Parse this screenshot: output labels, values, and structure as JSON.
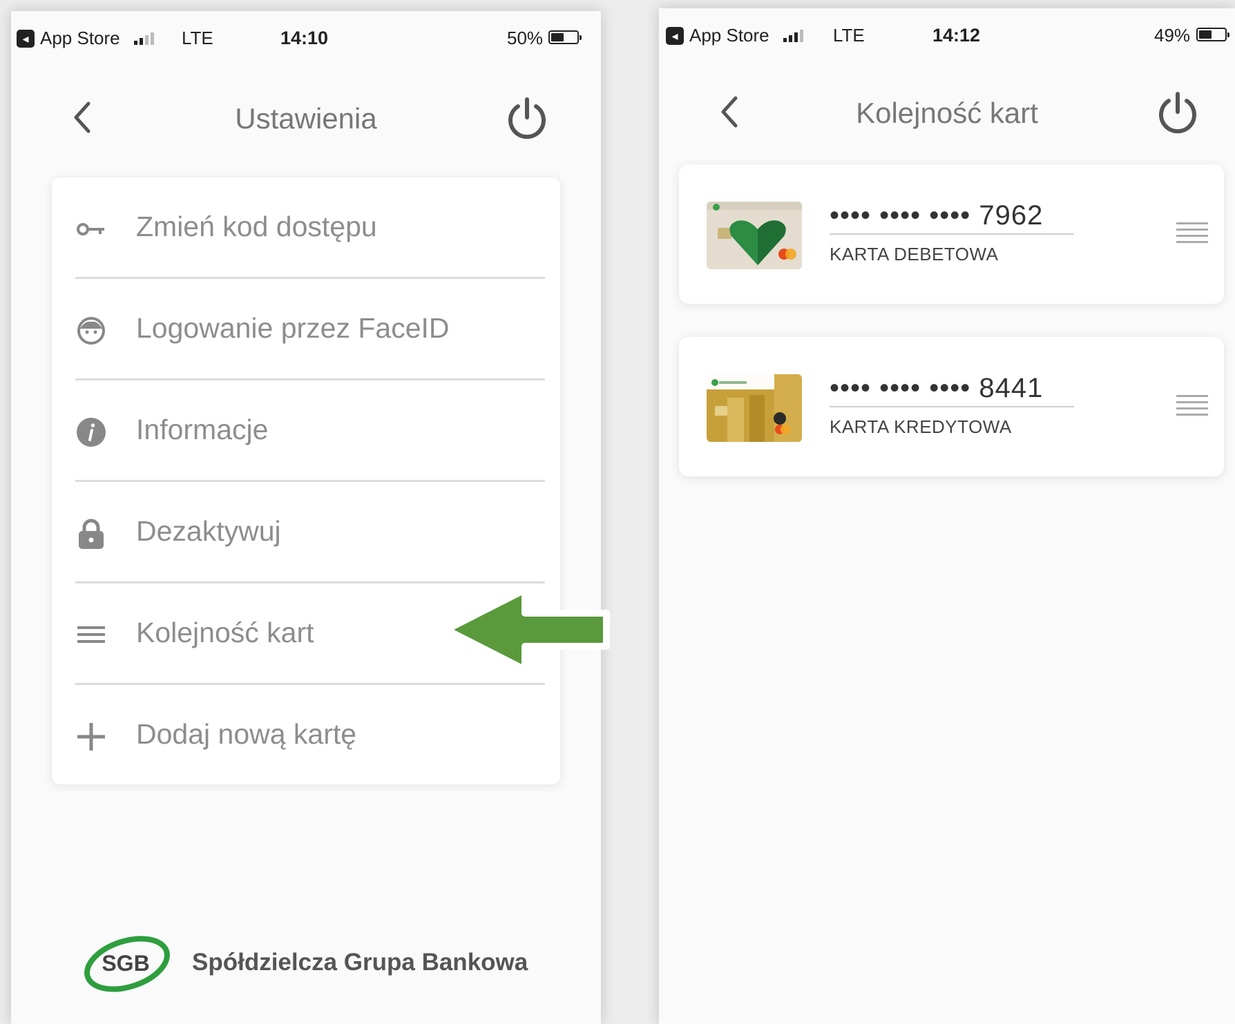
{
  "left_screen": {
    "status_bar": {
      "back_app": "App Store",
      "network": "LTE",
      "time": "14:10",
      "battery": "50%",
      "battery_level": 0.5
    },
    "header": {
      "title": "Ustawienia",
      "back_icon": "chevron-left-icon",
      "power_icon": "power-icon"
    },
    "menu": [
      {
        "label": "Zmień kod dostępu",
        "icon": "key-icon"
      },
      {
        "label": "Logowanie przez FaceID",
        "icon": "face-icon"
      },
      {
        "label": "Informacje",
        "icon": "info-icon"
      },
      {
        "label": "Dezaktywuj",
        "icon": "lock-icon"
      },
      {
        "label": "Kolejność kart",
        "icon": "list-icon"
      },
      {
        "label": "Dodaj nową kartę",
        "icon": "plus-icon"
      }
    ],
    "logo": {
      "mark": "SGB",
      "name": "Spółdzielcza Grupa Bankowa"
    },
    "annotation": {
      "icon": "arrow-left-icon",
      "color": "#5a9a3c"
    }
  },
  "right_screen": {
    "status_bar": {
      "back_app": "App Store",
      "network": "LTE",
      "time": "14:12",
      "battery": "49%",
      "battery_level": 0.49
    },
    "header": {
      "title": "Kolejność kart",
      "back_icon": "chevron-left-icon",
      "power_icon": "power-icon"
    },
    "cards": [
      {
        "number": "•••• •••• •••• 7962",
        "type": "KARTA DEBETOWA"
      },
      {
        "number": "•••• •••• •••• 8441",
        "type": "KARTA KREDYTOWA"
      }
    ]
  },
  "colors": {
    "brand_green": "#2e9e3e",
    "arrow_green": "#5a9a3c",
    "text_grey": "#8d8d8d"
  }
}
